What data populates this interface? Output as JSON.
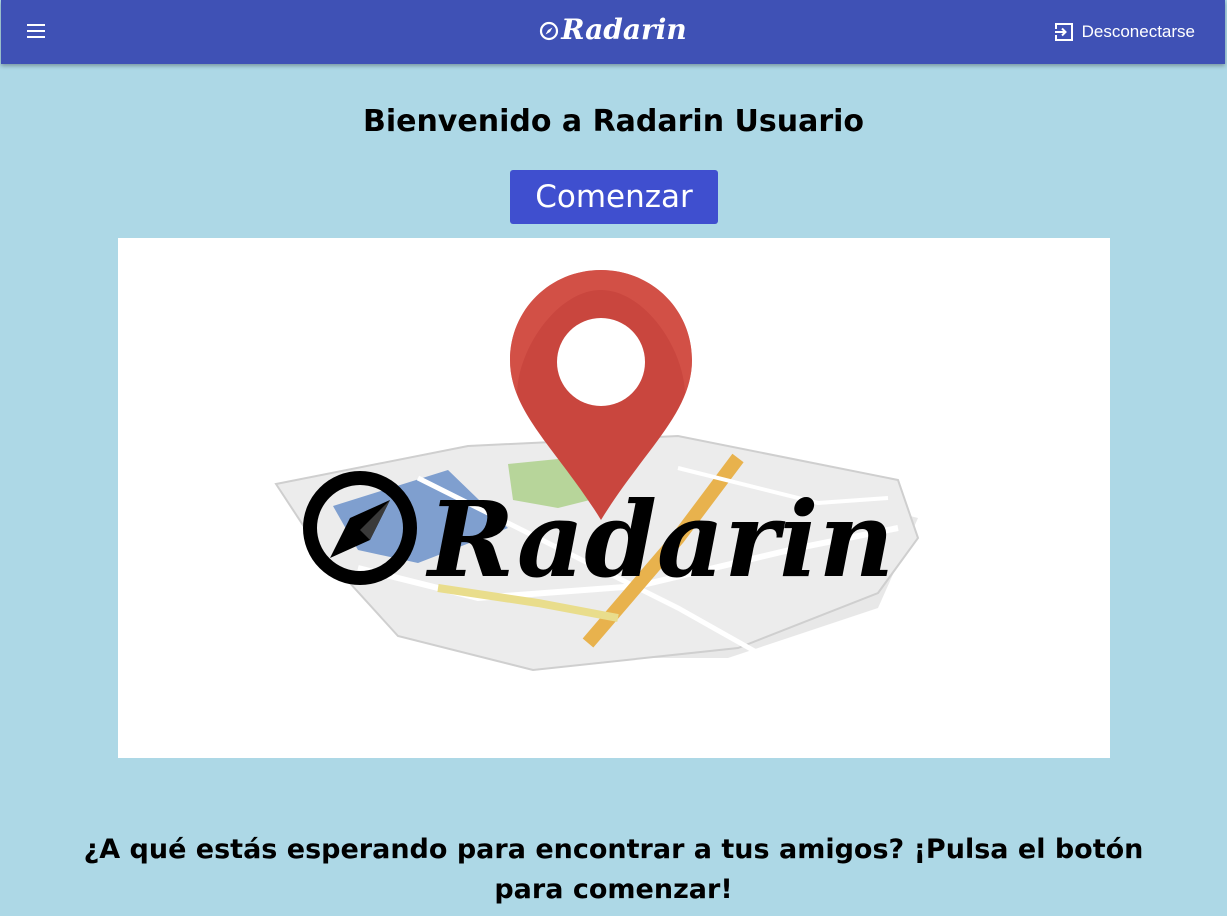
{
  "header": {
    "brand": "Radarin",
    "logout_label": "Desconectarse",
    "menu_icon": "hamburger-menu-icon",
    "logout_icon": "logout-icon",
    "brand_icon": "compass-icon",
    "color": "#3f51b5"
  },
  "main": {
    "welcome": "Bienvenido a Radarin Usuario",
    "start_label": "Comenzar",
    "hero_logo_text": "Radarin",
    "cta": "¿A qué estás esperando para encontrar a tus amigos? ¡Pulsa el botón para comenzar!",
    "background": "#add8e6",
    "button_color": "#3f4fcf"
  }
}
